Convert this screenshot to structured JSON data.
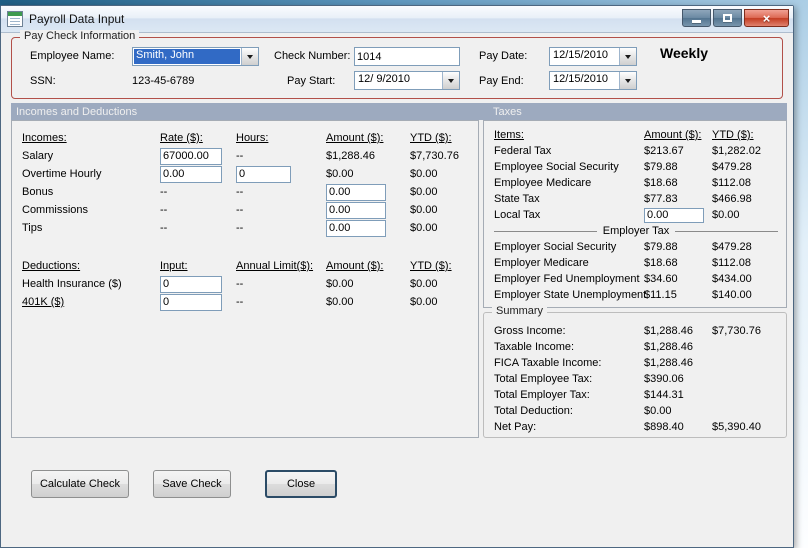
{
  "window": {
    "title": "Payroll Data Input"
  },
  "colors": {
    "selection_blue": "#316AC5",
    "section_header_bg": "#9DAABF",
    "groupbox_red_border": "#B25049",
    "close_button_red": "#C33C22"
  },
  "paycheck": {
    "title": "Pay Check Information",
    "employee_name": {
      "label": "Employee Name:",
      "value": "Smith, John"
    },
    "ssn": {
      "label": "SSN:",
      "value": "123-45-6789"
    },
    "check_number": {
      "label": "Check Number:",
      "value": "1014"
    },
    "pay_start": {
      "label": "Pay Start:",
      "value": "12/ 9/2010"
    },
    "pay_date": {
      "label": "Pay Date:",
      "value": "12/15/2010"
    },
    "pay_end": {
      "label": "Pay End:",
      "value": "12/15/2010"
    },
    "frequency": "Weekly"
  },
  "sections": {
    "incomes_header": "Incomes and Deductions",
    "taxes_header": "Taxes"
  },
  "incomes": {
    "headers": {
      "name": "Incomes:",
      "rate": "Rate ($):",
      "hours": "Hours:",
      "amount": "Amount ($):",
      "ytd": "YTD ($):"
    },
    "rows": [
      {
        "name": "Salary",
        "rate": "67000.00",
        "hours": "--",
        "amount": "$1,288.46",
        "ytd": "$7,730.76"
      },
      {
        "name": "Overtime Hourly",
        "rate": "0.00",
        "hours": "0",
        "amount": "$0.00",
        "ytd": "$0.00"
      },
      {
        "name": "Bonus",
        "rate": "--",
        "hours": "--",
        "amount": "0.00",
        "ytd": "$0.00"
      },
      {
        "name": "Commissions",
        "rate": "--",
        "hours": "--",
        "amount": "0.00",
        "ytd": "$0.00"
      },
      {
        "name": "Tips",
        "rate": "--",
        "hours": "--",
        "amount": "0.00",
        "ytd": "$0.00"
      }
    ]
  },
  "deductions": {
    "headers": {
      "name": "Deductions:",
      "input": "Input:",
      "limit": "Annual Limit($):",
      "amount": "Amount ($):",
      "ytd": "YTD ($):"
    },
    "rows": [
      {
        "name": "Health Insurance  ($)",
        "input": "0",
        "limit": "--",
        "amount": "$0.00",
        "ytd": "$0.00"
      },
      {
        "name": "401K  ($)",
        "input": "0",
        "limit": "--",
        "amount": "$0.00",
        "ytd": "$0.00"
      }
    ]
  },
  "taxes": {
    "headers": {
      "name": "Items:",
      "amount": "Amount ($):",
      "ytd": "YTD ($):"
    },
    "employee_rows": [
      {
        "name": "Federal Tax",
        "amount": "$213.67",
        "ytd": "$1,282.02"
      },
      {
        "name": "Employee Social Security",
        "amount": "$79.88",
        "ytd": "$479.28"
      },
      {
        "name": "Employee Medicare",
        "amount": "$18.68",
        "ytd": "$112.08"
      },
      {
        "name": "State Tax",
        "amount": "$77.83",
        "ytd": "$466.98"
      },
      {
        "name": "Local Tax",
        "amount": "0.00",
        "ytd": "$0.00"
      }
    ],
    "employer_header": "Employer Tax",
    "employer_rows": [
      {
        "name": "Employer Social Security",
        "amount": "$79.88",
        "ytd": "$479.28"
      },
      {
        "name": "Employer Medicare",
        "amount": "$18.68",
        "ytd": "$112.08"
      },
      {
        "name": "Employer Fed Unemployment",
        "amount": "$34.60",
        "ytd": "$434.00"
      },
      {
        "name": "Employer State Unemployment",
        "amount": "$11.15",
        "ytd": "$140.00"
      }
    ]
  },
  "summary": {
    "title": "Summary",
    "rows": [
      {
        "name": "Gross Income:",
        "amount": "$1,288.46",
        "ytd": "$7,730.76"
      },
      {
        "name": "Taxable Income:",
        "amount": "$1,288.46",
        "ytd": ""
      },
      {
        "name": "FICA Taxable Income:",
        "amount": "$1,288.46",
        "ytd": ""
      },
      {
        "name": "Total Employee Tax:",
        "amount": "$390.06",
        "ytd": ""
      },
      {
        "name": "Total Employer Tax:",
        "amount": "$144.31",
        "ytd": ""
      },
      {
        "name": "Total Deduction:",
        "amount": "$0.00",
        "ytd": ""
      },
      {
        "name": "Net Pay:",
        "amount": "$898.40",
        "ytd": "$5,390.40"
      }
    ]
  },
  "buttons": {
    "calculate": "Calculate Check",
    "save": "Save Check",
    "close": "Close"
  }
}
